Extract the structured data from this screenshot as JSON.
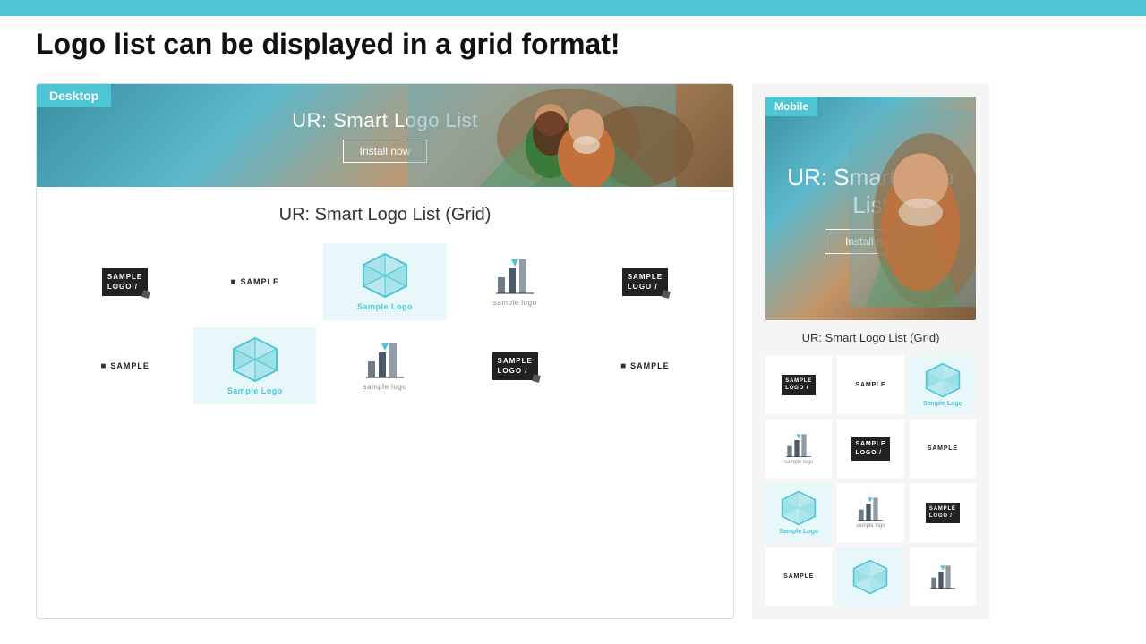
{
  "page": {
    "title": "Logo list can be displayed in a grid format!",
    "bg_color": "#2a2a2a"
  },
  "desktop": {
    "badge": "Desktop",
    "banner_title": "UR: Smart Logo List",
    "install_button": "Install now",
    "grid_title": "UR: Smart Logo List (Grid)"
  },
  "mobile": {
    "badge": "Mobile",
    "banner_title": "UR: Smart Logo List",
    "install_button": "Install now",
    "grid_title": "UR: Smart Logo List (Grid)"
  },
  "logos": {
    "sample_logo_text": "SAMPLE LOGO",
    "sample_text": "SAMPLE",
    "sample_label": "Sample Logo",
    "bar_label": "sample logo"
  }
}
